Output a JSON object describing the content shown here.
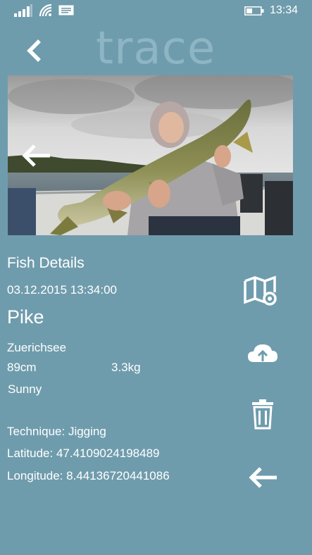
{
  "status_bar": {
    "time": "13:34",
    "icons": [
      "signal-icon",
      "wifi-icon",
      "message-icon",
      "battery-icon"
    ]
  },
  "header": {
    "app_title": "trace",
    "back_icon": "chevron-left-icon"
  },
  "photo": {
    "prev_icon": "arrow-left-icon"
  },
  "details": {
    "heading": "Fish Details",
    "date": "03.12.2015 13:34:00",
    "species": "Pike",
    "location": "Zuerichsee",
    "length": "89cm",
    "weight": "3.3kg",
    "weather": "Sunny",
    "technique": "Technique: Jigging",
    "latitude": "Latitude: 47.4109024198489",
    "longitude": "Longitude: 8.44136720441086"
  },
  "actions": {
    "icons": [
      "map-location-icon",
      "cloud-upload-icon",
      "trash-icon",
      "arrow-left-icon"
    ]
  },
  "colors": {
    "background": "#6f9cac",
    "title": "#8db5c4",
    "foreground": "#ffffff"
  }
}
